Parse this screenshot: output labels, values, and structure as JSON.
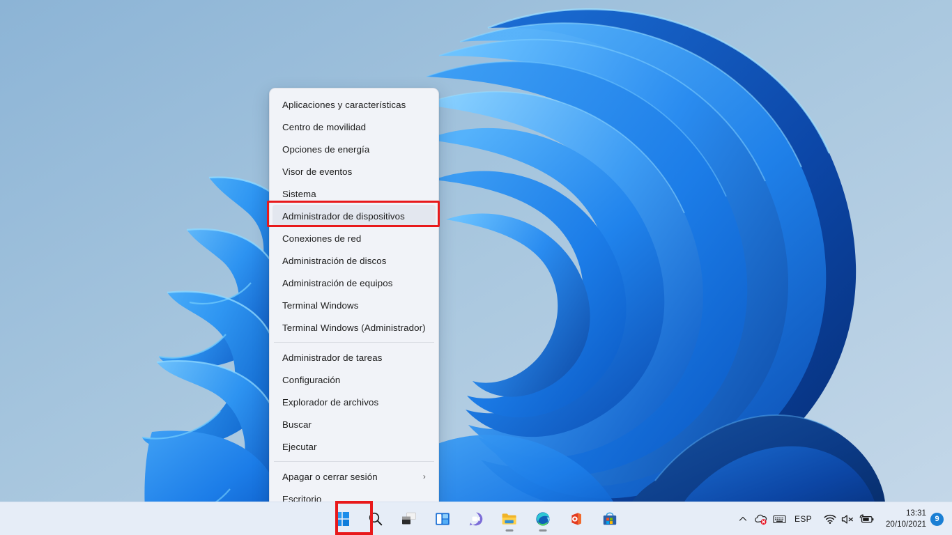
{
  "desktop": {
    "wallpaper_name": "windows-11-bloom-wallpaper",
    "background_color": "#8fb6d6"
  },
  "winx_menu": {
    "name": "quick-link-menu",
    "groups": [
      {
        "items": [
          {
            "label": "Aplicaciones y características",
            "name": "apps-and-features",
            "submenu": false,
            "highlighted": false
          },
          {
            "label": "Centro de movilidad",
            "name": "mobility-center",
            "submenu": false,
            "highlighted": false
          },
          {
            "label": "Opciones de energía",
            "name": "power-options",
            "submenu": false,
            "highlighted": false
          },
          {
            "label": "Visor de eventos",
            "name": "event-viewer",
            "submenu": false,
            "highlighted": false
          },
          {
            "label": "Sistema",
            "name": "system",
            "submenu": false,
            "highlighted": false
          },
          {
            "label": "Administrador de dispositivos",
            "name": "device-manager",
            "submenu": false,
            "highlighted": true
          },
          {
            "label": "Conexiones de red",
            "name": "network-connections",
            "submenu": false,
            "highlighted": false
          },
          {
            "label": "Administración de discos",
            "name": "disk-management",
            "submenu": false,
            "highlighted": false
          },
          {
            "label": "Administración de equipos",
            "name": "computer-management",
            "submenu": false,
            "highlighted": false
          },
          {
            "label": "Terminal Windows",
            "name": "windows-terminal",
            "submenu": false,
            "highlighted": false
          },
          {
            "label": "Terminal Windows (Administrador)",
            "name": "windows-terminal-admin",
            "submenu": false,
            "highlighted": false
          }
        ]
      },
      {
        "items": [
          {
            "label": "Administrador de tareas",
            "name": "task-manager",
            "submenu": false,
            "highlighted": false
          },
          {
            "label": "Configuración",
            "name": "settings",
            "submenu": false,
            "highlighted": false
          },
          {
            "label": "Explorador de archivos",
            "name": "file-explorer",
            "submenu": false,
            "highlighted": false
          },
          {
            "label": "Buscar",
            "name": "search",
            "submenu": false,
            "highlighted": false
          },
          {
            "label": "Ejecutar",
            "name": "run",
            "submenu": false,
            "highlighted": false
          }
        ]
      },
      {
        "items": [
          {
            "label": "Apagar o cerrar sesión",
            "name": "shutdown-or-signout",
            "submenu": true,
            "highlighted": false
          },
          {
            "label": "Escritorio",
            "name": "desktop",
            "submenu": false,
            "highlighted": false
          }
        ]
      }
    ],
    "submenu_glyph": "›"
  },
  "annotations": {
    "color": "#e8191b",
    "menu_item_target": "Administrador de dispositivos",
    "start_button_target": "Inicio"
  },
  "taskbar": {
    "background_color": "#e6edf7",
    "buttons": [
      {
        "name": "start-button",
        "icon": "windows-logo-icon",
        "label": "Inicio",
        "running": false
      },
      {
        "name": "search-button",
        "icon": "search-icon",
        "label": "Buscar",
        "running": false
      },
      {
        "name": "task-view-button",
        "icon": "task-view-icon",
        "label": "Vista de tareas",
        "running": false
      },
      {
        "name": "widgets-button",
        "icon": "widgets-icon",
        "label": "Widgets",
        "running": false
      },
      {
        "name": "chat-button",
        "icon": "chat-teams-icon",
        "label": "Chat",
        "running": false
      },
      {
        "name": "file-explorer-button",
        "icon": "file-explorer-icon",
        "label": "Explorador de archivos",
        "running": true
      },
      {
        "name": "edge-button",
        "icon": "edge-icon",
        "label": "Microsoft Edge",
        "running": true
      },
      {
        "name": "office-button",
        "icon": "office-icon",
        "label": "Office",
        "running": false
      },
      {
        "name": "store-button",
        "icon": "microsoft-store-icon",
        "label": "Microsoft Store",
        "running": false
      }
    ]
  },
  "tray": {
    "overflow_glyph": "∧",
    "items": [
      {
        "name": "show-hidden-icons-button",
        "icon": "chevron-up-icon"
      },
      {
        "name": "onedrive-tray-icon",
        "icon": "onedrive-error-icon"
      },
      {
        "name": "touch-keyboard-tray-icon",
        "icon": "keyboard-icon"
      }
    ],
    "language": "ESP",
    "quick_settings": [
      {
        "name": "wifi-tray-icon",
        "icon": "wifi-icon"
      },
      {
        "name": "volume-tray-icon",
        "icon": "speaker-muted-icon"
      },
      {
        "name": "battery-tray-icon",
        "icon": "battery-charging-icon"
      }
    ],
    "clock": {
      "time": "13:31",
      "date": "20/10/2021"
    },
    "notification_count": "9",
    "notification_color": "#1a7fd4"
  }
}
